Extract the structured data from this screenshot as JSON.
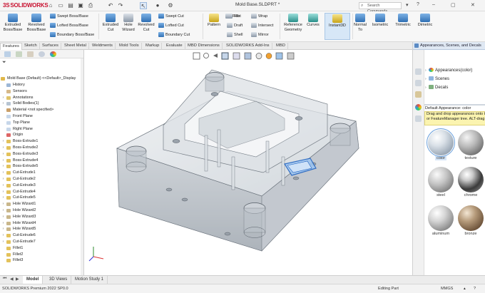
{
  "titlebar": {
    "logo": "SOLIDWORKS",
    "document_title": "Mold Base.SLDPRT *",
    "search_placeholder": "Search Commands"
  },
  "ribbon": {
    "extruded_boss": "Extruded Boss/Base",
    "revolved_boss": "Revolved Boss/Base",
    "swept_boss": "Swept Boss/Base",
    "lofted_boss": "Lofted Boss/Base",
    "boundary_boss": "Boundary Boss/Base",
    "extruded_cut": "Extruded Cut",
    "hole_wizard": "Hole Wizard",
    "revolved_cut": "Revolved Cut",
    "swept_cut": "Swept Cut",
    "lofted_cut": "Lofted Cut",
    "boundary_cut": "Boundary Cut",
    "pattern": "Pattern",
    "fillet": "Fillet",
    "rib": "Rib",
    "draft": "Draft",
    "shell": "Shell",
    "wrap": "Wrap",
    "intersect": "Intersect",
    "mirror": "Mirror",
    "reference_geometry": "Reference Geometry",
    "curves": "Curves",
    "instant3d": "Instant3D",
    "normal_to": "Normal To",
    "isometric": "Isometric",
    "trimetric": "Trimetric",
    "dimetric": "Dimetric"
  },
  "command_tabs": [
    "Features",
    "Sketch",
    "Surfaces",
    "Sheet Metal",
    "Weldments",
    "Mold Tools",
    "Markup",
    "Evaluate",
    "MBD Dimensions",
    "SOLIDWORKS Add-Ins",
    "MBD"
  ],
  "feature_tree": {
    "root": "Mold Base  (Default) <<Default>_Display",
    "items": [
      {
        "label": "History",
        "icon": "history-icon",
        "exp": false
      },
      {
        "label": "Sensors",
        "icon": "sensors-icon",
        "exp": false
      },
      {
        "label": "Annotations",
        "icon": "annotations-icon",
        "exp": true
      },
      {
        "label": "Solid Bodies(1)",
        "icon": "solid-bodies-icon",
        "exp": true
      },
      {
        "label": "Material <not specified>",
        "icon": "material-icon",
        "exp": false
      },
      {
        "label": "Front Plane",
        "icon": "plane-icon",
        "exp": false
      },
      {
        "label": "Top Plane",
        "icon": "plane-icon",
        "exp": false
      },
      {
        "label": "Right Plane",
        "icon": "plane-icon",
        "exp": false
      },
      {
        "label": "Origin",
        "icon": "origin-icon",
        "exp": false
      },
      {
        "label": "Boss-Extrude1",
        "icon": "boss-extrude-icon",
        "exp": true
      },
      {
        "label": "Boss-Extrude2",
        "icon": "boss-extrude-icon",
        "exp": true
      },
      {
        "label": "Boss-Extrude3",
        "icon": "boss-extrude-icon",
        "exp": true
      },
      {
        "label": "Boss-Extrude4",
        "icon": "boss-extrude-icon",
        "exp": true
      },
      {
        "label": "Boss-Extrude5",
        "icon": "boss-extrude-icon",
        "exp": true
      },
      {
        "label": "Cut-Extrude1",
        "icon": "cut-extrude-icon",
        "exp": true
      },
      {
        "label": "Cut-Extrude2",
        "icon": "cut-extrude-icon",
        "exp": true
      },
      {
        "label": "Cut-Extrude3",
        "icon": "cut-extrude-icon",
        "exp": true
      },
      {
        "label": "Cut-Extrude4",
        "icon": "cut-extrude-icon",
        "exp": true
      },
      {
        "label": "Cut-Extrude5",
        "icon": "cut-extrude-icon",
        "exp": true
      },
      {
        "label": "Hole Wizard1",
        "icon": "hole-wizard-icon",
        "exp": true
      },
      {
        "label": "Hole Wizard2",
        "icon": "hole-wizard-icon",
        "exp": true
      },
      {
        "label": "Hole Wizard3",
        "icon": "hole-wizard-icon",
        "exp": true
      },
      {
        "label": "Hole Wizard4",
        "icon": "hole-wizard-icon",
        "exp": true
      },
      {
        "label": "Hole Wizard5",
        "icon": "hole-wizard-icon",
        "exp": true
      },
      {
        "label": "Cut-Extrude6",
        "icon": "cut-extrude-icon",
        "exp": true
      },
      {
        "label": "Cut-Extrude7",
        "icon": "cut-extrude-icon",
        "exp": true
      },
      {
        "label": "Fillet1",
        "icon": "fillet-icon",
        "exp": false
      },
      {
        "label": "Fillet2",
        "icon": "fillet-icon",
        "exp": false
      },
      {
        "label": "Fillet3",
        "icon": "fillet-icon",
        "exp": false
      }
    ]
  },
  "task_pane": {
    "header": "Appearances, Scenes, and Decals",
    "tree": [
      "Appearances(color)",
      "Scenes",
      "Decals"
    ],
    "default_appearance": "Default Appearance: color",
    "hint_line1": "Drag and drop appearances onto the mo",
    "hint_line2": "or FeatureManager tree. ALT-drag to c",
    "swatches": [
      {
        "label": "color",
        "selected": true
      },
      {
        "label": "texture",
        "selected": false
      },
      {
        "label": "steel",
        "selected": false
      },
      {
        "label": "chrome",
        "selected": false
      },
      {
        "label": "aluminum",
        "selected": false
      },
      {
        "label": "bronze",
        "selected": false
      }
    ]
  },
  "bottom_tabs": [
    "Model",
    "3D Views",
    "Motion Study 1"
  ],
  "statusbar": {
    "version": "SOLIDWORKS Premium 2022 SP0.0",
    "mode": "Editing Part",
    "units": "MMGS"
  }
}
